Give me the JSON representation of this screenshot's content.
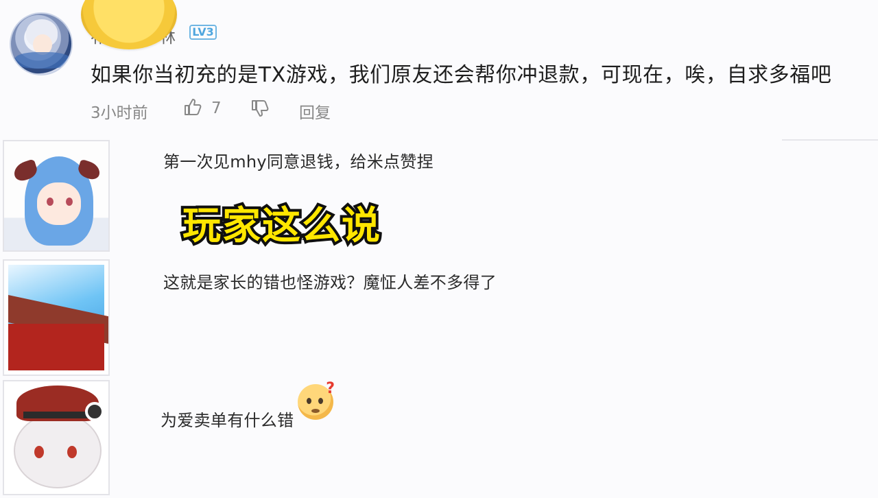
{
  "top_comment": {
    "username_start": "祁",
    "username_end": "林",
    "level_badge": "LV3",
    "text": "如果你当初充的是TX游戏，我们原友还会帮你冲退款，可现在，唉，自求多福吧",
    "time": "3小时前",
    "like_count": "7",
    "reply_label": "回复"
  },
  "replies": [
    {
      "text": "第一次见mhy同意退钱，给米点赞捏"
    },
    {
      "text": "这就是家长的错也怪游戏？魔怔人差不多得了"
    },
    {
      "text": "为爱卖单有什么错"
    }
  ],
  "overlay": {
    "caption": "玩家这么说"
  },
  "colors": {
    "caption_fill": "#ffe600",
    "caption_stroke": "#111111",
    "badge_blue": "#4fa6de",
    "meta_gray": "#888888"
  },
  "icons": [
    "thumbs-up-icon",
    "thumbs-down-icon",
    "confused-emoji-icon"
  ]
}
